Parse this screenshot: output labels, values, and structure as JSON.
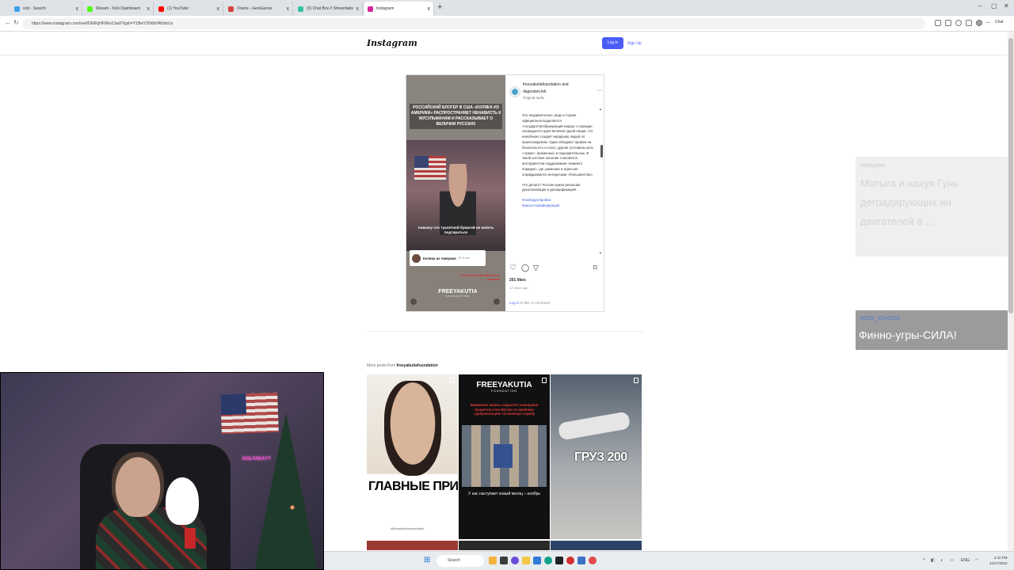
{
  "browser": {
    "tabs": [
      {
        "label": "vick - Search",
        "color": "#3aa0e8"
      },
      {
        "label": "Stream - Kick Dashboard",
        "color": "#53fc18"
      },
      {
        "label": "(1) YouTube",
        "color": "#ff0000"
      },
      {
        "label": "Oracle - GeoGuessr",
        "color": "#d84040"
      },
      {
        "label": "(3) Chat Box // Streamlabs",
        "color": "#31c3a2"
      },
      {
        "label": "Instagram",
        "color": "#d6249f"
      }
    ],
    "new_tab": "+",
    "close_glyph": "x",
    "url": "https://www.instagram.com/reel/DEWqHF6Ke2Jad/?igsh=Y1BwY2N0bHA5dm1s",
    "chat_label": "Chat",
    "window_controls": [
      "–",
      "▢",
      "✕"
    ]
  },
  "instagram": {
    "logo": "Instagram",
    "login_label": "Log in",
    "signup_label": "Sign Up"
  },
  "post": {
    "video": {
      "headline": "РОССИЙСКИЙ БЛОГЕР В США «КОЛЯКА ИЗ АМЕРИКИ» РАСПРОСТРАНЯЕТ НЕНАВИСТЬ К МУСУЛЬМАНАМ И РАССКАЗЫВАЕТ О ВЕЛИЧИИ РУССКИХ",
      "subtitle": "повозку что туалетной бумагой не копить подтираться",
      "channel_name": "Коляка из Америки",
      "channel_meta": "87.8 тыс.",
      "red_caption": "Сторонник ФревАкутия в расизма",
      "brand": "FREEYAKUTIA",
      "brand_sub": "FOUNDATION"
    },
    "author_line1": "freeyakutiafoundation and",
    "author_line2": "dagestani.lek",
    "audio": "Original audio",
    "more": "···",
    "caption_p1": "Это неудивительно, ведь в стране официально выделяется «государствообразующий народ» и граждан насаждается идея величия одной нации, что неизбежно создаёт иерархию людей по происхождению. Одни обладают правом на безопасность и голос, другие уготована роль «чужих», временных и подозрительных. В такой системе насилие становится инструментом поддержания «нижнего порядка», где унижение и агрессия оправдываются интересами «большинства».",
    "caption_p2": "Что делать? России нужна реальная деколонизация и денацификация!",
    "hashtags": [
      "#свободуотфобии",
      "#расистскаяфедерация"
    ],
    "likes": "201 likes",
    "time": "12 hours ago",
    "login_link": "Log in",
    "comment_suffix": " to like or comment."
  },
  "more_posts": {
    "prefix": "More posts from ",
    "account": "freeyakutiafoundation",
    "tiles": [
      {
        "text": "ГЛАВНЫЕ ПРИНЦИП СВОБОДНОЙ ЯКУТ",
        "handle": "@freeyakutiafoundation"
      },
      {
        "brand": "FREEYAKUTIA",
        "brand_sub": "FOUNDATION",
        "red": "Внимание! Запись закрытого совещания Правительства Якутии по вербовке «добровольцев» на военную службу",
        "white": "У нас наступает новый месяц – ноябрь"
      },
      {
        "text": "ГРУЗ 200"
      }
    ]
  },
  "webcam": {
    "neon": "KOLYAKA??"
  },
  "overlays": {
    "first": {
      "user": "ratbayeva",
      "text": "Мотыга и нахуя Гунь деградирующих ин двигателей в ..."
    },
    "second": {
      "user": "RE52_X0HOSA",
      "text": "Финно-угры-СИЛА!"
    }
  },
  "taskbar": {
    "search": "Search",
    "tray_lang": "ENG",
    "time": "2:32 PM",
    "date": "12/17/2023"
  }
}
